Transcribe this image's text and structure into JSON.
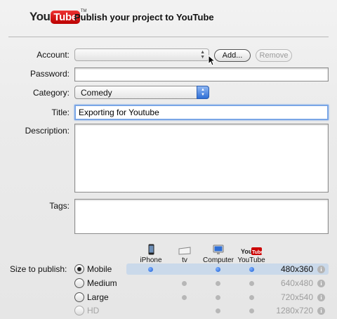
{
  "header": {
    "logo_you": "You",
    "logo_tube": "Tube",
    "logo_tm": "TM",
    "title": "Publish your project to YouTube"
  },
  "form": {
    "account_label": "Account:",
    "account_value": "",
    "add_button": "Add...",
    "remove_button": "Remove",
    "password_label": "Password:",
    "password_value": "",
    "category_label": "Category:",
    "category_value": "Comedy",
    "title_label": "Title:",
    "title_value": "Exporting for Youtube",
    "description_label": "Description:",
    "description_value": "",
    "tags_label": "Tags:",
    "tags_value": ""
  },
  "devices": [
    {
      "name": "iPhone",
      "icon": "iphone-icon"
    },
    {
      "name": "tv",
      "icon": "apple-tv-icon"
    },
    {
      "name": "Computer",
      "icon": "computer-icon"
    },
    {
      "name": "YouTube",
      "icon": "youtube-icon"
    }
  ],
  "size": {
    "label": "Size to publish:",
    "options": [
      {
        "name": "Mobile",
        "resolution": "480x360",
        "selected": true,
        "enabled": true
      },
      {
        "name": "Medium",
        "resolution": "640x480",
        "selected": false,
        "enabled": true
      },
      {
        "name": "Large",
        "resolution": "720x540",
        "selected": false,
        "enabled": true
      },
      {
        "name": "HD",
        "resolution": "1280x720",
        "selected": false,
        "enabled": false
      }
    ]
  },
  "colors": {
    "selected_row": "#cad9ea",
    "focus_ring": "#7aa6e6",
    "youtube_red": "#cc0000"
  }
}
